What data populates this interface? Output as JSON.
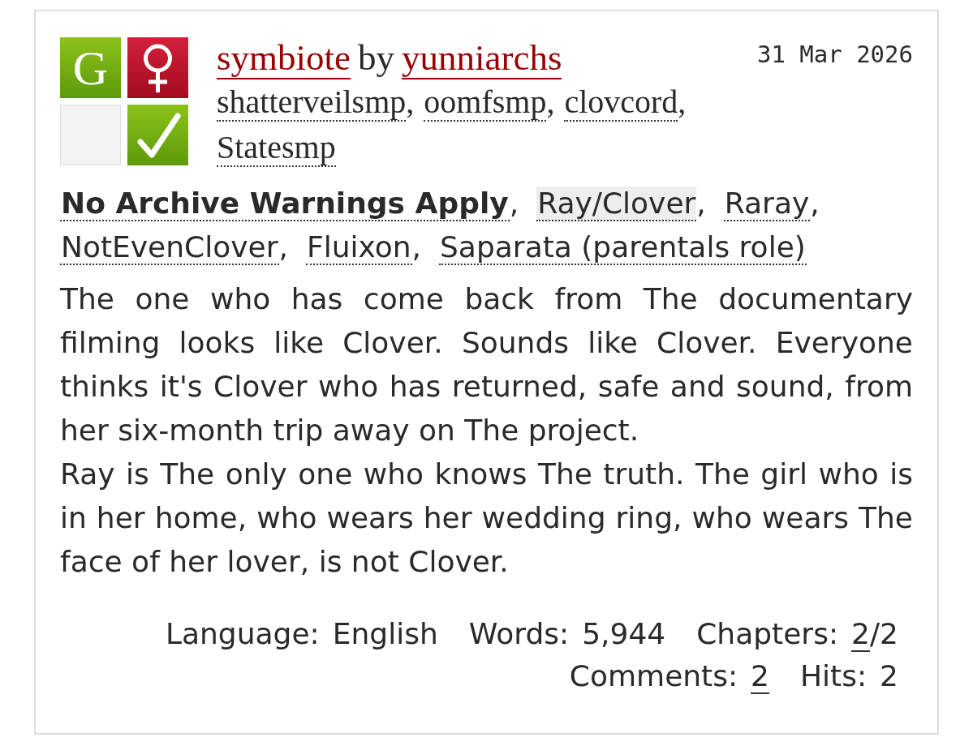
{
  "icons": [
    {
      "kind": "rating",
      "text": "G"
    },
    {
      "kind": "category"
    },
    {
      "kind": "warning"
    },
    {
      "kind": "complete"
    }
  ],
  "title": "symbiote",
  "by": "by",
  "author": "yunniarchs",
  "fandoms": [
    {
      "text": "shatterveilsmp",
      "sep": ","
    },
    {
      "text": "oomfsmp",
      "sep": ","
    },
    {
      "text": "clovcord",
      "sep": ","
    },
    {
      "text": "Statesmp"
    }
  ],
  "date": "31 Mar 2026",
  "tags": [
    {
      "kind": "warning",
      "text": "No Archive Warnings Apply",
      "sep": ","
    },
    {
      "kind": "relationship",
      "text": "Ray/Clover",
      "sep": ","
    },
    {
      "kind": "character",
      "text": "Raray",
      "sep": ","
    },
    {
      "kind": "character",
      "text": "NotEvenClover",
      "sep": ","
    },
    {
      "kind": "character",
      "text": "Fluixon",
      "sep": ","
    },
    {
      "kind": "character",
      "text": "Saparata (parentals role)"
    }
  ],
  "summary": [
    "The one who has come back from The documentary filming looks like Clover. Sounds like Clover. Everyone thinks it's Clover who has returned, safe and sound, from her six-month trip away on The project.",
    "Ray is The only one who knows The truth. The girl who is in her home, who wears her wedding ring, who wears The face of her lover, is not Clover."
  ],
  "stats": [
    [
      {
        "label": "Language:",
        "value": "English"
      },
      {
        "label": "Words:",
        "value": "5,944"
      },
      {
        "label": "Chapters:",
        "link": "2",
        "value": "/2"
      }
    ],
    [
      {
        "label": "Comments:",
        "link": "2"
      },
      {
        "label": "Hits:",
        "value": "2"
      }
    ]
  ]
}
